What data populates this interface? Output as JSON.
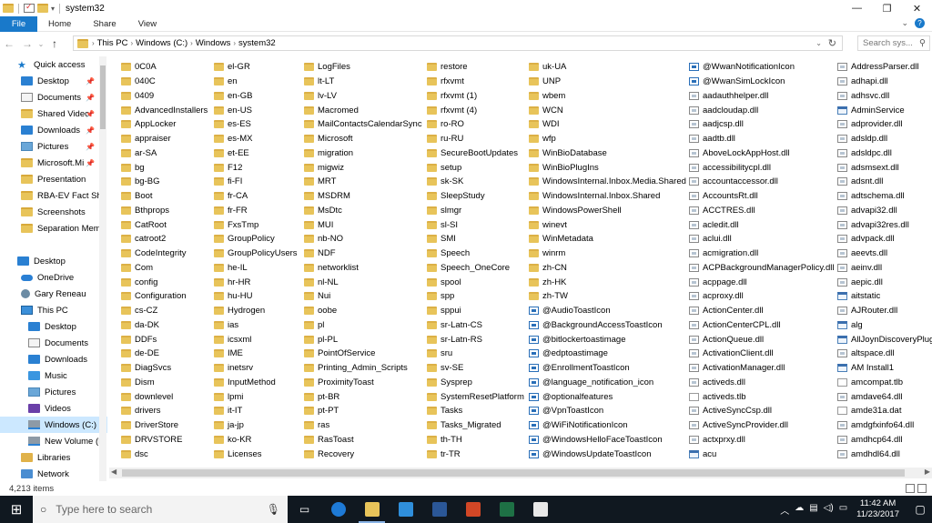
{
  "window": {
    "title": "system32"
  },
  "ribbon": {
    "file": "File",
    "tabs": [
      "Home",
      "Share",
      "View"
    ]
  },
  "address": {
    "crumbs": [
      "This PC",
      "Windows (C:)",
      "Windows",
      "system32"
    ]
  },
  "search": {
    "placeholder": "Search sys..."
  },
  "nav": [
    {
      "label": "Quick access",
      "icon": "quick-access-star-icon",
      "cls": "star",
      "pin": false,
      "indent": 1
    },
    {
      "label": "Desktop",
      "icon": "desktop-icon",
      "cls": "desk",
      "pin": true,
      "indent": 2
    },
    {
      "label": "Documents",
      "icon": "documents-icon",
      "cls": "doc",
      "pin": true,
      "indent": 2
    },
    {
      "label": "Shared Video",
      "icon": "folder-icon",
      "cls": "fold",
      "pin": true,
      "indent": 2
    },
    {
      "label": "Downloads",
      "icon": "downloads-icon",
      "cls": "dl",
      "pin": true,
      "indent": 2
    },
    {
      "label": "Pictures",
      "icon": "pictures-icon",
      "cls": "pic",
      "pin": true,
      "indent": 2
    },
    {
      "label": "Microsoft.Mi",
      "icon": "folder-icon",
      "cls": "fold",
      "pin": true,
      "indent": 2
    },
    {
      "label": "Presentation",
      "icon": "folder-icon",
      "cls": "fold",
      "pin": false,
      "indent": 2
    },
    {
      "label": "RBA-EV Fact She",
      "icon": "folder-icon",
      "cls": "fold",
      "pin": false,
      "indent": 2
    },
    {
      "label": "Screenshots",
      "icon": "folder-icon",
      "cls": "fold",
      "pin": false,
      "indent": 2
    },
    {
      "label": "Separation Mem",
      "icon": "folder-icon",
      "cls": "fold",
      "pin": false,
      "indent": 2
    },
    {
      "label": "",
      "icon": "",
      "cls": "",
      "pin": false,
      "indent": 0
    },
    {
      "label": "Desktop",
      "icon": "desktop-icon",
      "cls": "desk",
      "pin": false,
      "indent": 1
    },
    {
      "label": "OneDrive",
      "icon": "onedrive-icon",
      "cls": "od",
      "pin": false,
      "indent": 2
    },
    {
      "label": "Gary Reneau",
      "icon": "user-icon",
      "cls": "user",
      "pin": false,
      "indent": 2
    },
    {
      "label": "This PC",
      "icon": "this-pc-icon",
      "cls": "pc",
      "pin": false,
      "indent": 2
    },
    {
      "label": "Desktop",
      "icon": "desktop-icon",
      "cls": "desk",
      "pin": false,
      "indent": 3
    },
    {
      "label": "Documents",
      "icon": "documents-icon",
      "cls": "doc",
      "pin": false,
      "indent": 3
    },
    {
      "label": "Downloads",
      "icon": "downloads-icon",
      "cls": "dl",
      "pin": false,
      "indent": 3
    },
    {
      "label": "Music",
      "icon": "music-icon",
      "cls": "music",
      "pin": false,
      "indent": 3
    },
    {
      "label": "Pictures",
      "icon": "pictures-icon",
      "cls": "pic",
      "pin": false,
      "indent": 3
    },
    {
      "label": "Videos",
      "icon": "videos-icon",
      "cls": "vid",
      "pin": false,
      "indent": 3
    },
    {
      "label": "Windows (C:)",
      "icon": "drive-icon",
      "cls": "drive",
      "pin": false,
      "indent": 3,
      "selected": true
    },
    {
      "label": "New Volume (F",
      "icon": "drive-icon",
      "cls": "drive",
      "pin": false,
      "indent": 3
    },
    {
      "label": "Libraries",
      "icon": "libraries-icon",
      "cls": "lib",
      "pin": false,
      "indent": 2
    },
    {
      "label": "Network",
      "icon": "network-icon",
      "cls": "net",
      "pin": false,
      "indent": 2
    }
  ],
  "columns": [
    {
      "items": [
        "0C0A",
        "040C",
        "0409",
        "AdvancedInstallers",
        "AppLocker",
        "appraiser",
        "ar-SA",
        "bg",
        "bg-BG",
        "Boot",
        "Bthprops",
        "CatRoot",
        "catroot2",
        "CodeIntegrity",
        "Com",
        "config",
        "Configuration",
        "cs-CZ",
        "da-DK",
        "DDFs",
        "de-DE",
        "DiagSvcs",
        "Dism",
        "downlevel",
        "drivers",
        "DriverStore",
        "DRVSTORE",
        "dsc"
      ]
    },
    {
      "items": [
        "el-GR",
        "en",
        "en-GB",
        "en-US",
        "es-ES",
        "es-MX",
        "et-EE",
        "F12",
        "fi-FI",
        "fr-CA",
        "fr-FR",
        "FxsTmp",
        "GroupPolicy",
        "GroupPolicyUsers",
        "he-IL",
        "hr-HR",
        "hu-HU",
        "Hydrogen",
        "ias",
        "icsxml",
        "IME",
        "inetsrv",
        "InputMethod",
        "lpmi",
        "it-IT",
        "ja-jp",
        "ko-KR",
        "Licenses"
      ]
    },
    {
      "items": [
        "LogFiles",
        "lt-LT",
        "lv-LV",
        "Macromed",
        "MailContactsCalendarSync",
        "Microsoft",
        "migration",
        "migwiz",
        "MRT",
        "MSDRM",
        "MsDtc",
        "MUI",
        "nb-NO",
        "NDF",
        "networklist",
        "nl-NL",
        "Nui",
        "oobe",
        "pl",
        "pl-PL",
        "PointOfService",
        "Printing_Admin_Scripts",
        "ProximityToast",
        "pt-BR",
        "pt-PT",
        "ras",
        "RasToast",
        "Recovery"
      ]
    },
    {
      "items": [
        "restore",
        "rfxvmt",
        "rfxvmt (1)",
        "rfxvmt (4)",
        "ro-RO",
        "ru-RU",
        "SecureBootUpdates",
        "setup",
        "sk-SK",
        "SleepStudy",
        "slmgr",
        "sl-SI",
        "SMI",
        "Speech",
        "Speech_OneCore",
        "spool",
        "spp",
        "sppui",
        "sr-Latn-CS",
        "sr-Latn-RS",
        "sru",
        "sv-SE",
        "Sysprep",
        "SystemResetPlatform",
        "Tasks",
        "Tasks_Migrated",
        "th-TH",
        "tr-TR"
      ]
    },
    {
      "items": [
        "uk-UA",
        "UNP",
        "wbem",
        "WCN",
        "WDI",
        "wfp",
        "WinBioDatabase",
        "WinBioPlugIns",
        "WindowsInternal.Inbox.Media.Shared",
        "WindowsInternal.Inbox.Shared",
        "WindowsPowerShell",
        "winevt",
        "WinMetadata",
        "winrm",
        "zh-CN",
        "zh-HK",
        "zh-TW",
        "@AudioToastIcon",
        "@BackgroundAccessToastIcon",
        "@bitlockertoastimage",
        "@edptoastimage",
        "@EnrollmentToastIcon",
        "@language_notification_icon",
        "@optionalfeatures",
        "@VpnToastIcon",
        "@WiFiNotificationIcon",
        "@WindowsHelloFaceToastIcon",
        "@WindowsUpdateToastIcon"
      ]
    },
    {
      "items": [
        "@WwanNotificationIcon",
        "@WwanSimLockIcon",
        "aadauthhelper.dll",
        "aadcloudap.dll",
        "aadjcsp.dll",
        "aadtb.dll",
        "AboveLockAppHost.dll",
        "accessibilitycpl.dll",
        "accountaccessor.dll",
        "AccountsRt.dll",
        "ACCTRES.dll",
        "acledit.dll",
        "aclui.dll",
        "acmigration.dll",
        "ACPBackgroundManagerPolicy.dll",
        "acppage.dll",
        "acproxy.dll",
        "ActionCenter.dll",
        "ActionCenterCPL.dll",
        "ActionQueue.dll",
        "ActivationClient.dll",
        "ActivationManager.dll",
        "activeds.dll",
        "activeds.tlb",
        "ActiveSyncCsp.dll",
        "ActiveSyncProvider.dll",
        "actxprxy.dll",
        "acu"
      ]
    },
    {
      "items": [
        "AddressParser.dll",
        "adhapi.dll",
        "adhsvc.dll",
        "AdminService",
        "adprovider.dll",
        "adsldp.dll",
        "adsldpc.dll",
        "adsmsext.dll",
        "adsnt.dll",
        "adtschema.dll",
        "advapi32.dll",
        "advapi32res.dll",
        "advpack.dll",
        "aeevts.dll",
        "aeinv.dll",
        "aepic.dll",
        "aitstatic",
        "AJRouter.dll",
        "alg",
        "AllJoynDiscoveryPlugin",
        "altspace.dll",
        "AM Install1",
        "amcompat.tlb",
        "amdave64.dll",
        "amde31a.dat",
        "amdgfxinfo64.dll",
        "amdhcp64.dll",
        "amdhdl64.dll"
      ]
    }
  ],
  "status": {
    "count": "4,213 items"
  },
  "taskbar": {
    "search_placeholder": "Type here to search",
    "time": "11:42 AM",
    "date": "11/23/2017",
    "apps": [
      "task-view",
      "edge",
      "file-explorer",
      "store",
      "word",
      "powerpoint",
      "excel",
      "photos"
    ]
  }
}
